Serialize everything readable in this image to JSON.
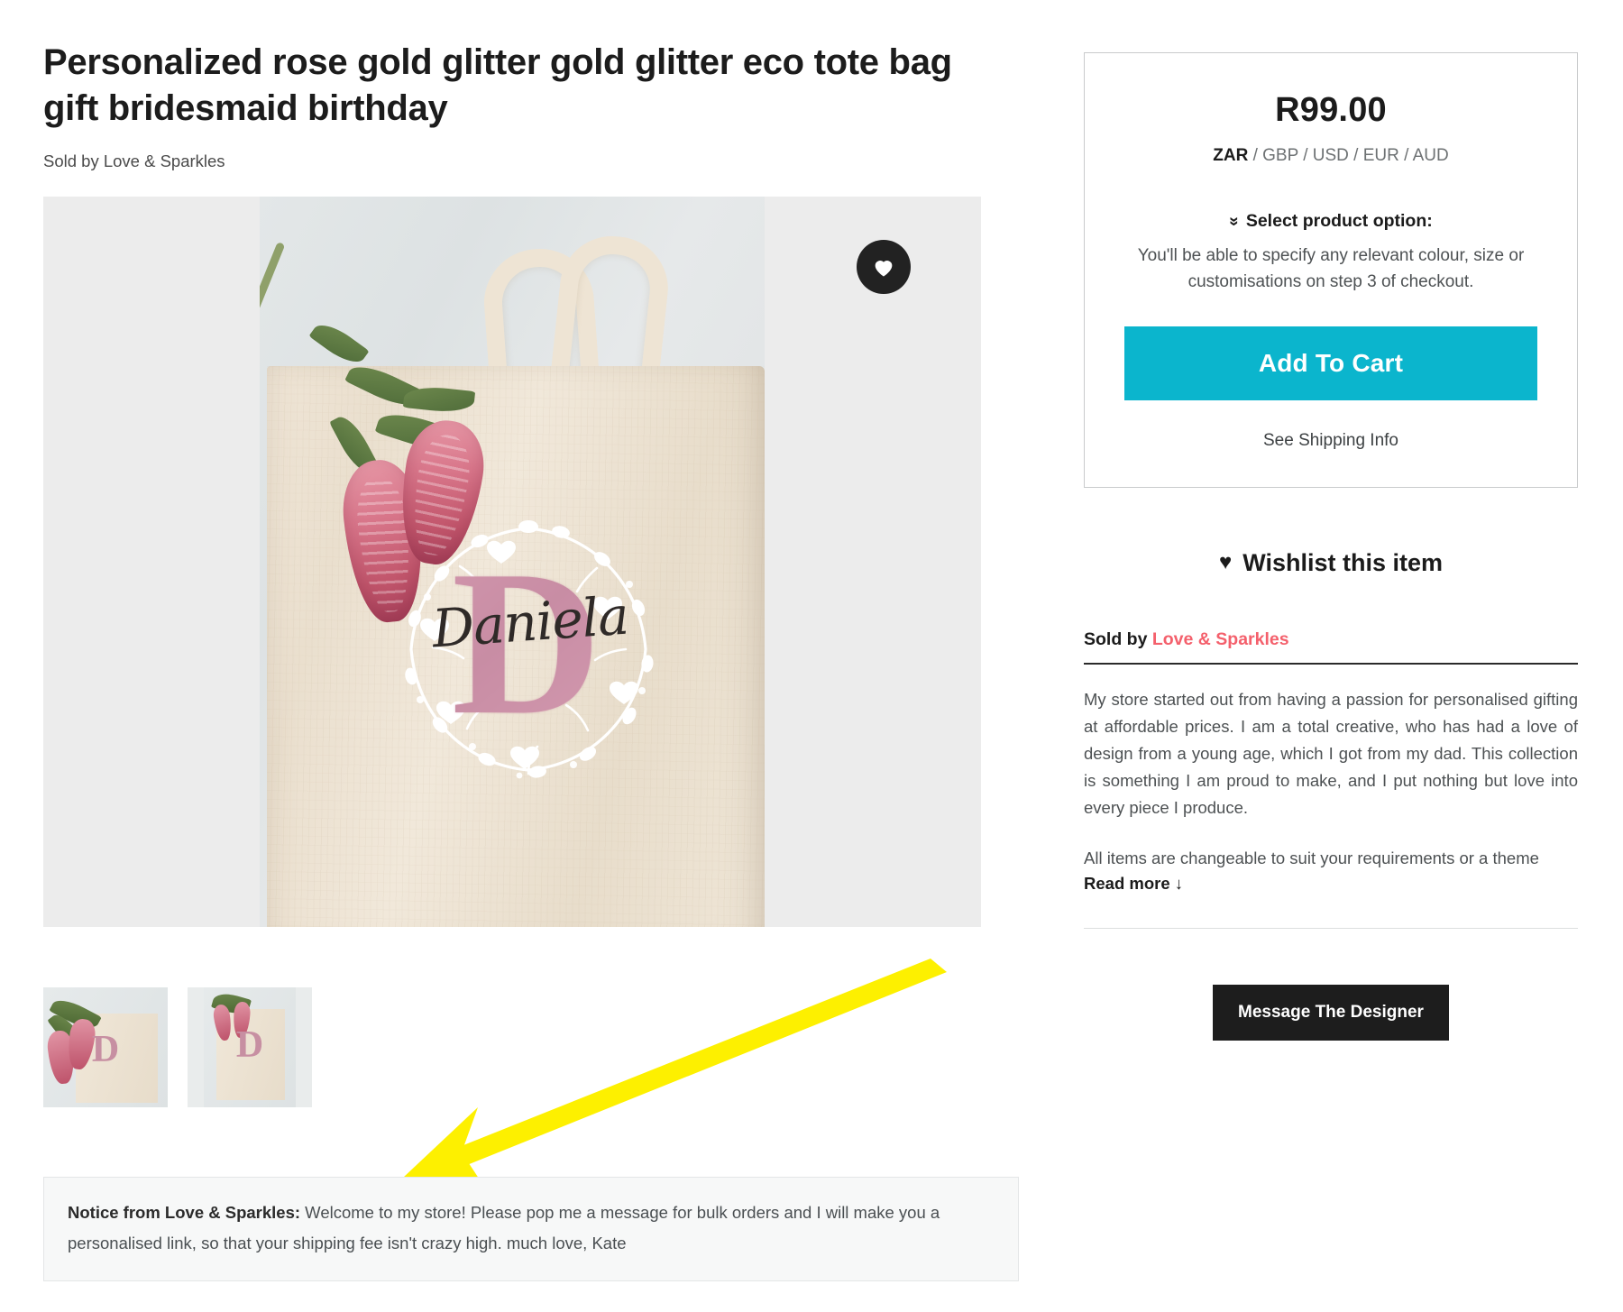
{
  "product": {
    "title": "Personalized rose gold glitter gold glitter eco tote bag gift bridesmaid birthday",
    "sold_by_line": "Sold by Love & Sparkles",
    "seller_name": "Love & Sparkles",
    "monogram_letter": "D",
    "personalised_name": "Daniela"
  },
  "gallery": {
    "wishlist_heart_icon": "heart-icon",
    "thumbnails": [
      {
        "label": "tote bag with protea flowers front view"
      },
      {
        "label": "tote bag with protea flowers angled view"
      }
    ]
  },
  "price_card": {
    "price": "R99.00",
    "currency_selected": "ZAR",
    "currency_others": " / GBP / USD / EUR / AUD",
    "select_option_label": "Select product option:",
    "select_option_chevron": "chevron-double-down-icon",
    "option_help": "You'll be able to specify any relevant colour, size or customisations on step 3 of checkout.",
    "add_to_cart_label": "Add To Cart",
    "add_to_cart_color": "#0bb5cd",
    "shipping_info_label": "See Shipping Info"
  },
  "wishlist": {
    "heart_glyph": "♥",
    "label": "Wishlist this item"
  },
  "seller": {
    "sold_by_prefix": "Sold by ",
    "name": "Love & Sparkles",
    "name_color": "#f4606c",
    "description_paragraph": "My store started out from having a passion for personalised gifting at affordable prices. I am a total creative, who has had a love of design from a young age, which I got from my dad. This collection is something I am proud to make, and I put nothing but love into every piece I produce.",
    "description_truncated_line": "All items are changeable to suit your requirements or a theme",
    "read_more_label": "Read more",
    "read_more_arrow": "↓",
    "message_designer_label": "Message The Designer"
  },
  "notice": {
    "prefix": "Notice from Love & Sparkles:",
    "body": " Welcome to my store! Please pop me a message for bulk orders and I will make you a personalised link, so that your shipping fee isn't crazy high. much love, Kate"
  },
  "annotation": {
    "arrow_color": "#fdf000",
    "arrow_name": "yellow-pointer-arrow"
  }
}
